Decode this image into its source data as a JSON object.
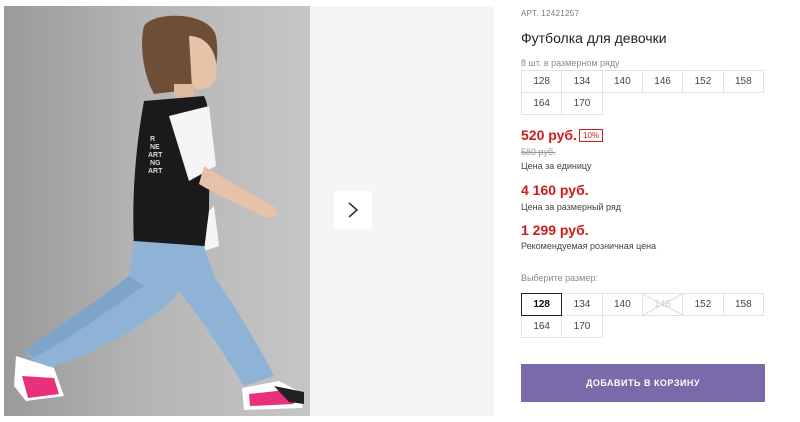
{
  "product": {
    "sku_prefix": "АРТ.",
    "sku_value": "12421257",
    "title": "Футболка для девочки",
    "pack_note": "8 шт. в размерном ряду"
  },
  "pack_sizes": {
    "row1": [
      "128",
      "134",
      "140",
      "146",
      "152",
      "158"
    ],
    "row2": [
      "164",
      "170"
    ]
  },
  "pricing": {
    "unit_price": "520 руб.",
    "discount_badge": "10%",
    "old_price": "580 руб.",
    "unit_label": "Цена за единицу",
    "pack_price": "4 160 руб.",
    "pack_label": "Цена за размерный ряд",
    "retail_price": "1 299 руб.",
    "retail_label": "Рекомендуемая розничная цена"
  },
  "size_select": {
    "label": "Выберите размер:",
    "row1": [
      "128",
      "134",
      "140",
      "146",
      "152",
      "158"
    ],
    "row2": [
      "164",
      "170"
    ],
    "selected": "128",
    "unavailable": [
      "146"
    ]
  },
  "cart": {
    "add_button_label": "ДОБАВИТЬ В КОРЗИНУ"
  },
  "colors": {
    "price_red": "#d01b1b",
    "button_purple": "#7b6aa9"
  },
  "icons": {
    "gallery_next": "chevron-right-icon"
  }
}
